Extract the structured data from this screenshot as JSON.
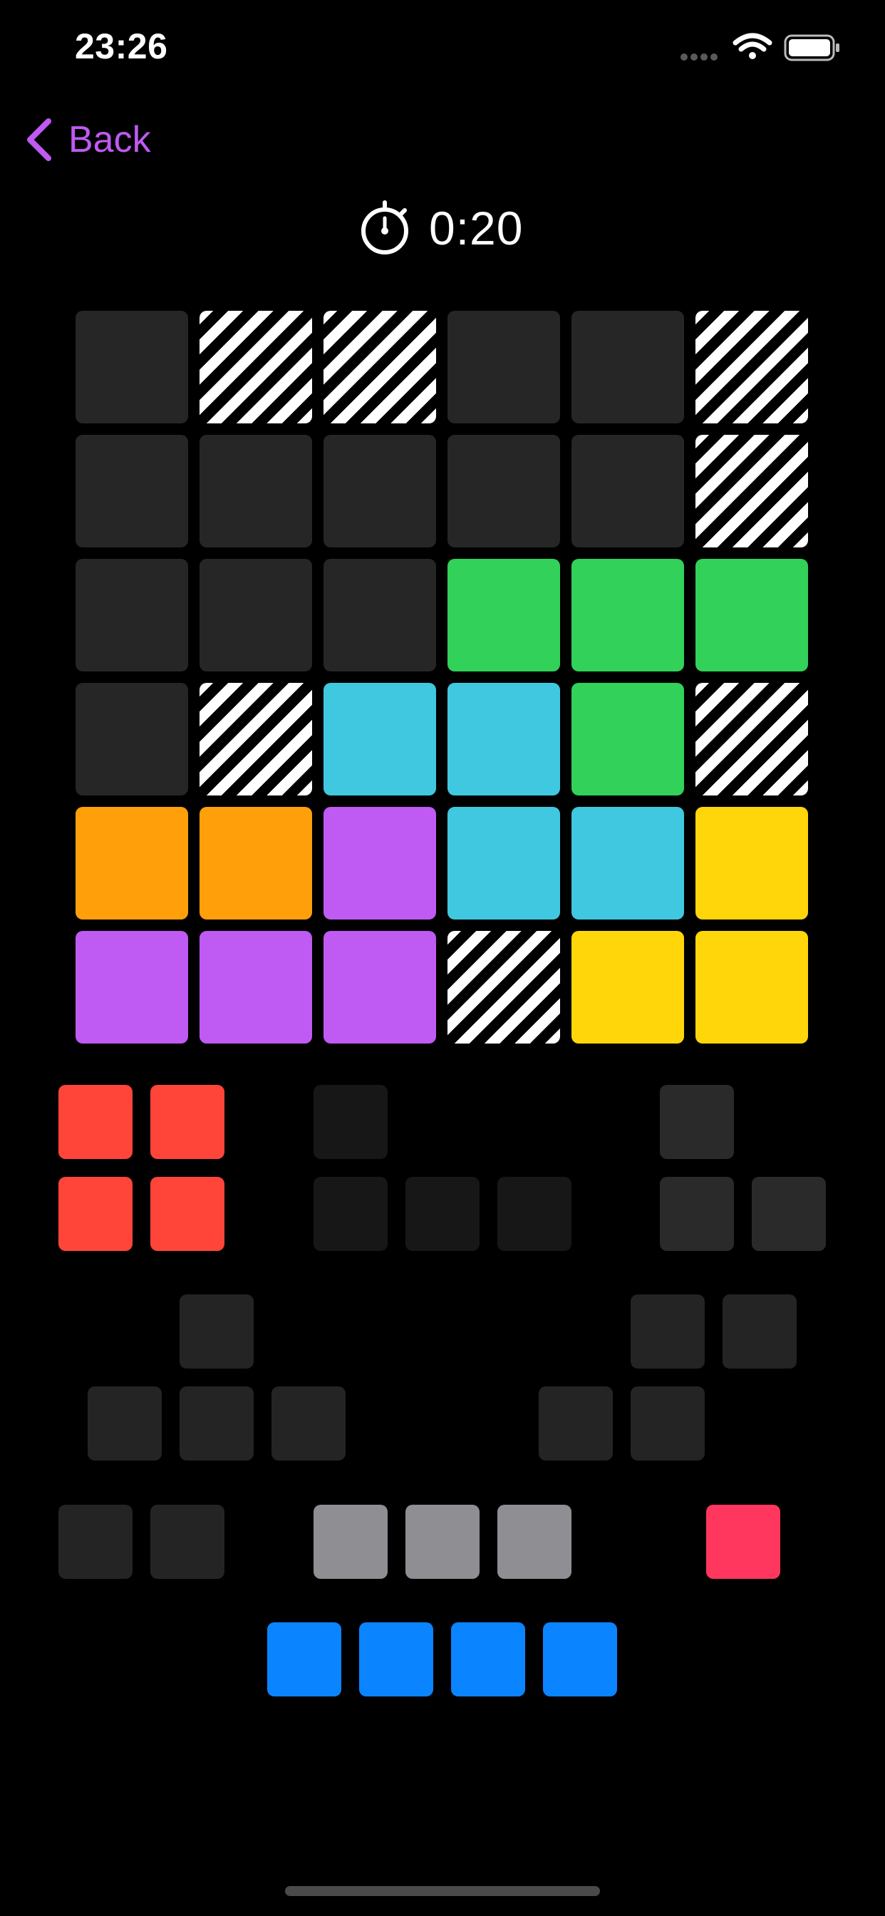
{
  "status_bar": {
    "time": "23:26",
    "icons": [
      "signal-dots-icon",
      "wifi-icon",
      "battery-icon"
    ]
  },
  "nav": {
    "back_label": "Back",
    "back_icon": "chevron-left-icon"
  },
  "timer": {
    "icon": "stopwatch-icon",
    "value": "0:20"
  },
  "colors": {
    "accent": "#BF5AF2",
    "empty": "#262626",
    "stripe_light": "#ffffff",
    "stripe_dark": "#000000",
    "green": "#32D159",
    "cyan": "#40C8E0",
    "orange": "#FF9F0A",
    "purple": "#BF5AF2",
    "yellow": "#FFD60A",
    "red": "#FF453A",
    "pink": "#FF375F",
    "gray": "#8E8E93",
    "blue": "#0A84FF",
    "dark": "#242424",
    "darker": "#171717",
    "dim": "#2A2A2A"
  },
  "board": {
    "rows": 6,
    "cols": 6,
    "cells": [
      [
        "empty",
        "blocked",
        "blocked",
        "empty",
        "empty",
        "blocked"
      ],
      [
        "empty",
        "empty",
        "empty",
        "empty",
        "empty",
        "blocked"
      ],
      [
        "empty",
        "empty",
        "empty",
        "green",
        "green",
        "green"
      ],
      [
        "empty",
        "blocked",
        "cyan",
        "cyan",
        "green",
        "blocked"
      ],
      [
        "orange",
        "orange",
        "purple",
        "cyan",
        "cyan",
        "yellow"
      ],
      [
        "purple",
        "purple",
        "purple",
        "blocked",
        "yellow",
        "yellow"
      ]
    ]
  },
  "pieces": [
    {
      "name": "piece-square-red",
      "color": "red",
      "placed": false,
      "cells": [
        [
          0,
          0
        ],
        [
          1,
          0
        ],
        [
          0,
          1
        ],
        [
          1,
          1
        ]
      ]
    },
    {
      "name": "piece-l-dark",
      "color": "darker",
      "placed": true,
      "cells": [
        [
          0,
          0
        ],
        [
          0,
          1
        ],
        [
          1,
          1
        ],
        [
          2,
          1
        ]
      ]
    },
    {
      "name": "piece-corner-dark",
      "color": "dim",
      "placed": true,
      "cells": [
        [
          0,
          0
        ],
        [
          0,
          1
        ],
        [
          1,
          1
        ]
      ]
    },
    {
      "name": "piece-t-dark",
      "color": "dark",
      "placed": true,
      "cells": [
        [
          1,
          0
        ],
        [
          0,
          1
        ],
        [
          1,
          1
        ],
        [
          2,
          1
        ]
      ]
    },
    {
      "name": "piece-s-dark",
      "color": "dark",
      "placed": true,
      "cells": [
        [
          1,
          0
        ],
        [
          2,
          0
        ],
        [
          0,
          1
        ],
        [
          1,
          1
        ]
      ]
    },
    {
      "name": "piece-domino-dark",
      "color": "dark",
      "placed": true,
      "cells": [
        [
          0,
          0
        ],
        [
          1,
          0
        ]
      ]
    },
    {
      "name": "piece-line3-gray",
      "color": "gray",
      "placed": false,
      "cells": [
        [
          0,
          0
        ],
        [
          1,
          0
        ],
        [
          2,
          0
        ]
      ]
    },
    {
      "name": "piece-single-pink",
      "color": "pink",
      "placed": false,
      "cells": [
        [
          0,
          0
        ]
      ]
    },
    {
      "name": "piece-line4-blue",
      "color": "blue",
      "placed": false,
      "cells": [
        [
          0,
          0
        ],
        [
          1,
          0
        ],
        [
          2,
          0
        ],
        [
          3,
          0
        ]
      ]
    }
  ]
}
